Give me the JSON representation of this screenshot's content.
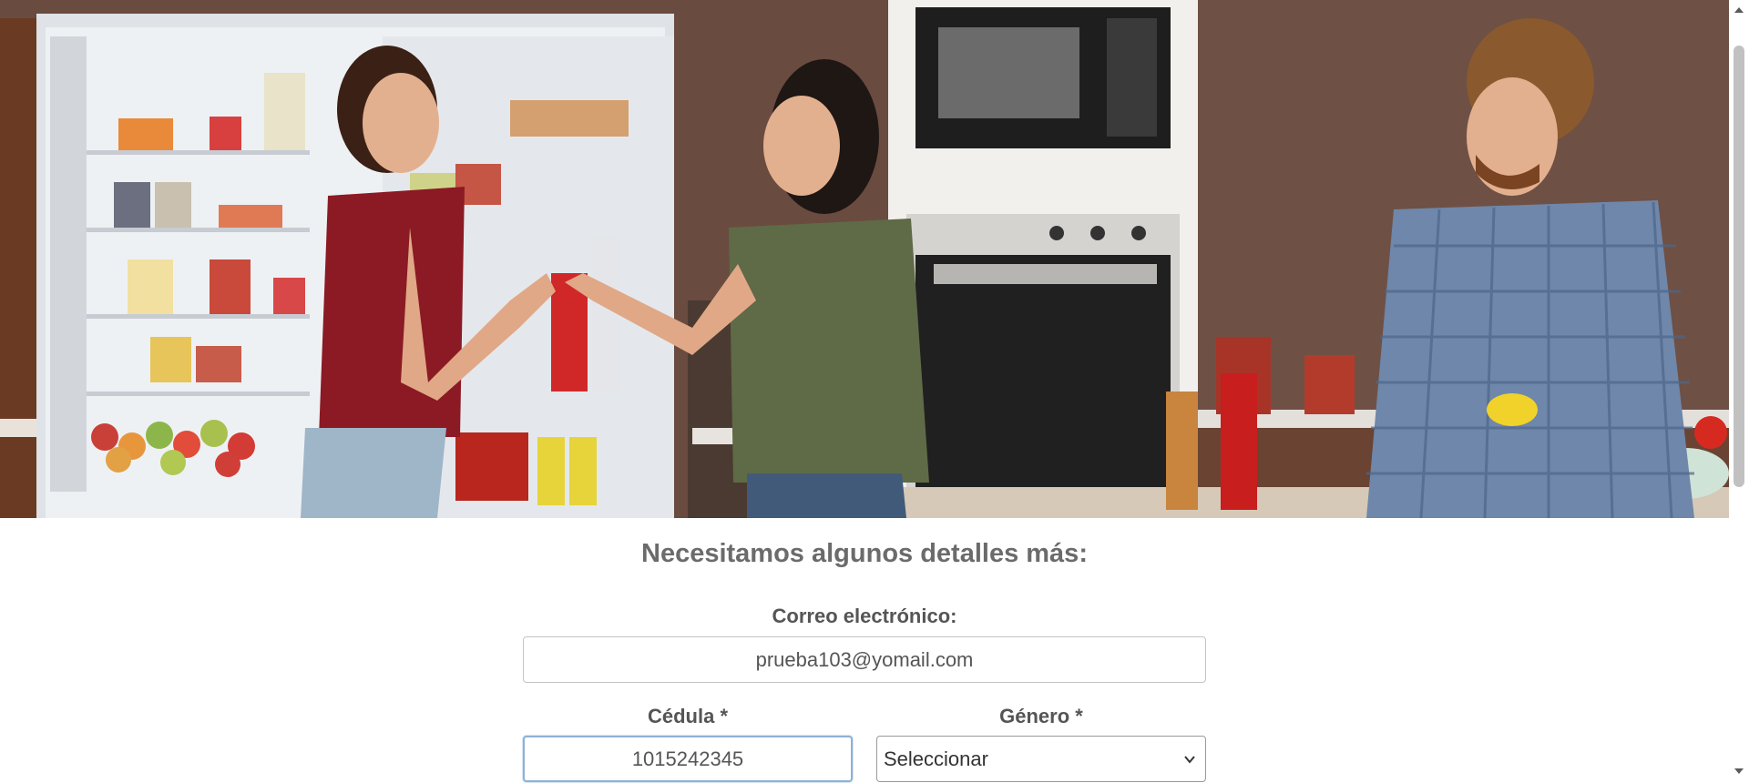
{
  "hero": {
    "image_icon": "kitchen-scene-photo"
  },
  "form": {
    "title": "Necesitamos algunos detalles más:",
    "email": {
      "label": "Correo electrónico:",
      "value": "prueba103@yomail.com"
    },
    "cedula": {
      "label": "Cédula *",
      "value": "1015242345"
    },
    "genero": {
      "label": "Género *",
      "selected": "Seleccionar",
      "icon": "chevron-down-icon"
    }
  },
  "scrollbar": {
    "up_icon": "arrow-up-icon",
    "down_icon": "arrow-down-icon"
  },
  "colors": {
    "title": "#6b6b6b",
    "label": "#555555",
    "input_border": "#c4c4c4",
    "focus_border": "#8fb1d6",
    "wall": "#6a4b3f"
  }
}
